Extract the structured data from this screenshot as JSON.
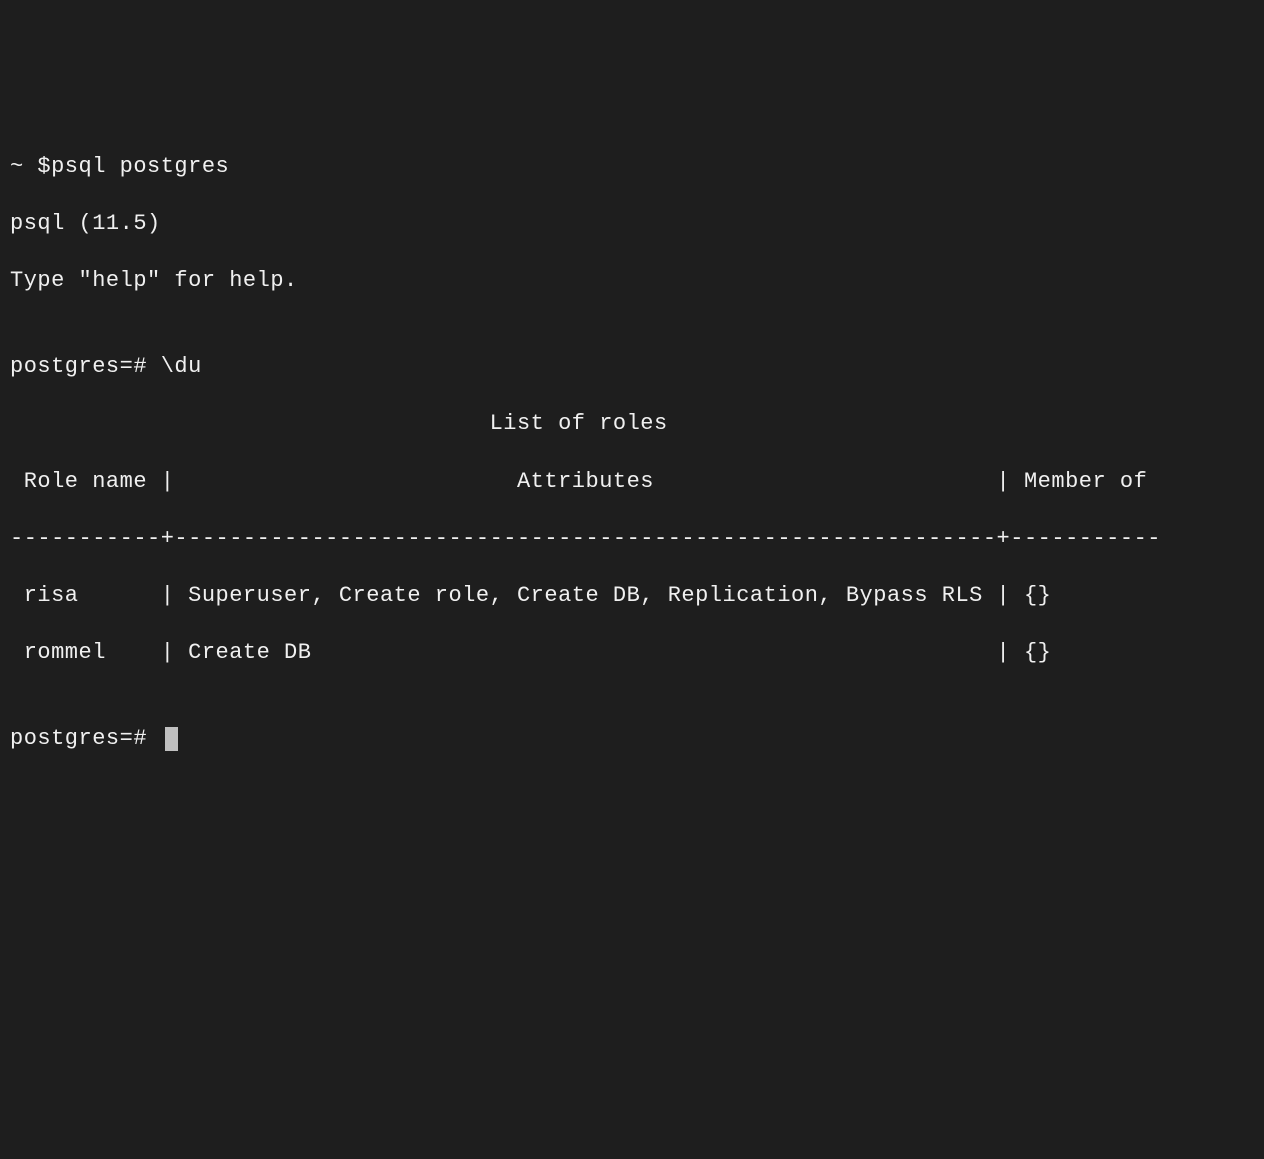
{
  "lines": {
    "shell_prompt": "~ $psql postgres",
    "version": "psql (11.5)",
    "help_hint": "Type \"help\" for help.",
    "blank1": "",
    "psql_prompt_du": "postgres=# \\du",
    "title": "                                   List of roles",
    "header": " Role name |                         Attributes                         | Member of ",
    "separator": "-----------+------------------------------------------------------------+-----------",
    "row1": " risa      | Superuser, Create role, Create DB, Replication, Bypass RLS | {}",
    "row2": " rommel    | Create DB                                                  | {}",
    "blank2": "",
    "psql_prompt_empty": "postgres=# "
  },
  "table": {
    "title": "List of roles",
    "columns": [
      "Role name",
      "Attributes",
      "Member of"
    ],
    "rows": [
      {
        "role_name": "risa",
        "attributes": "Superuser, Create role, Create DB, Replication, Bypass RLS",
        "member_of": "{}"
      },
      {
        "role_name": "rommel",
        "attributes": "Create DB",
        "member_of": "{}"
      }
    ]
  },
  "commands": {
    "shell": "psql postgres",
    "psql_du": "\\du"
  },
  "version_string": "11.5"
}
